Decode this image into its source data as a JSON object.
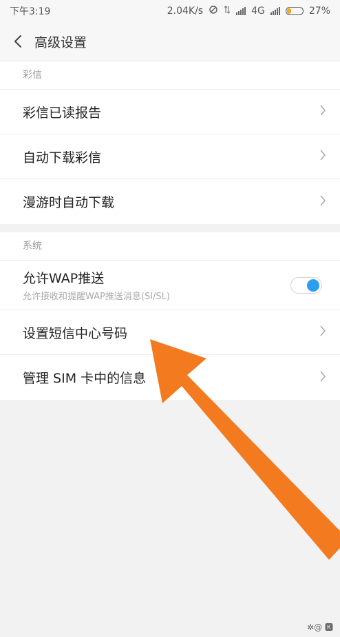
{
  "status_bar": {
    "time": "下午3:19",
    "net_speed": "2.04K/s",
    "network": "4G",
    "battery": "27%",
    "battery_level": 0.27
  },
  "header": {
    "title": "高级设置"
  },
  "sections": {
    "mms": {
      "title": "彩信",
      "items": [
        {
          "label": "彩信已读报告"
        },
        {
          "label": "自动下载彩信"
        },
        {
          "label": "漫游时自动下载"
        }
      ]
    },
    "system": {
      "title": "系统",
      "wap": {
        "label": "允许WAP推送",
        "sub": "允许接收和提醒WAP推送消息(SI/SL)",
        "enabled": true
      },
      "items": [
        {
          "label": "设置短信中心号码"
        },
        {
          "label": "管理 SIM 卡中的信息"
        }
      ]
    }
  },
  "colors": {
    "accent": "#2a9ff2",
    "annotation_arrow": "#f47a20"
  }
}
